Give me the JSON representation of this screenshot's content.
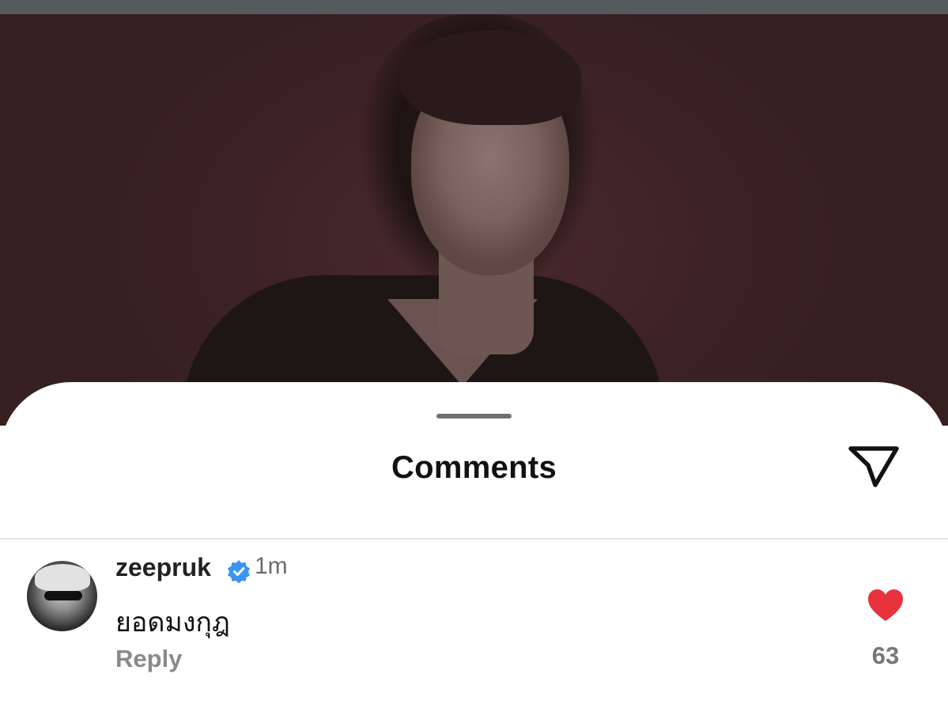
{
  "sheet": {
    "title": "Comments"
  },
  "comments": [
    {
      "username": "zeepruk",
      "verified": true,
      "time": "1m",
      "text": "ยอดมงกุฎ",
      "reply_label": "Reply",
      "likes": "63",
      "liked": true
    }
  ],
  "colors": {
    "like_red": "#e8323c",
    "verified_blue": "#3b95f0",
    "sheet_bg": "#ffffff"
  },
  "icons": {
    "send": "send-icon",
    "like": "heart-icon",
    "verified": "verified-badge-icon"
  }
}
